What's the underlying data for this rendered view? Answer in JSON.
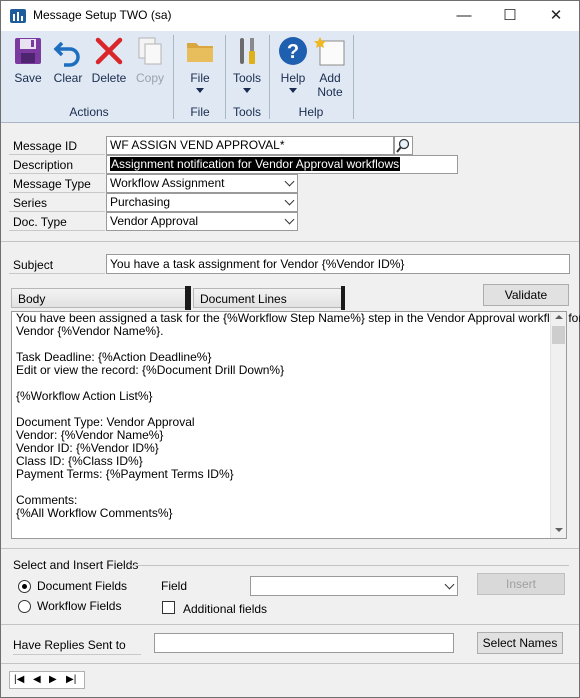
{
  "window": {
    "title": "Message Setup   TWO (sa)",
    "minimize_glyph": "—",
    "maximize_glyph": "☐",
    "close_glyph": "✕"
  },
  "ribbon": {
    "groups": [
      {
        "label": "Actions",
        "buttons": [
          {
            "label": "Save",
            "icon": "save-icon"
          },
          {
            "label": "Clear",
            "icon": "undo-icon"
          },
          {
            "label": "Delete",
            "icon": "delete-icon"
          },
          {
            "label": "Copy",
            "icon": "copy-icon",
            "disabled": true
          }
        ]
      },
      {
        "label": "File",
        "buttons": [
          {
            "label": "File",
            "icon": "folder-icon"
          }
        ]
      },
      {
        "label": "Tools",
        "buttons": [
          {
            "label": "Tools",
            "icon": "tools-icon"
          }
        ]
      },
      {
        "label": "Help",
        "buttons": [
          {
            "label": "Help",
            "icon": "help-icon"
          },
          {
            "label_line1": "Add",
            "label_line2": "Note",
            "icon": "add-note-icon"
          }
        ]
      }
    ]
  },
  "form": {
    "message_id": {
      "label": "Message ID",
      "value": "WF ASSIGN VEND APPROVAL*"
    },
    "description": {
      "label": "Description",
      "value": "Assignment notification for Vendor Approval workflows"
    },
    "message_type": {
      "label": "Message Type",
      "value": "Workflow Assignment"
    },
    "series": {
      "label": "Series",
      "value": "Purchasing"
    },
    "doc_type": {
      "label": "Doc. Type",
      "value": "Vendor Approval"
    },
    "subject": {
      "label": "Subject",
      "value": "You have a task assignment for Vendor  {%Vendor ID%}"
    }
  },
  "tabs": {
    "body": "Body",
    "document_lines": "Document Lines"
  },
  "validate_label": "Validate",
  "body_lines": [
    "You have been assigned a task for the {%Workflow Step Name%} step in the Vendor Approval workflow for",
    "Vendor {%Vendor Name%}.",
    "",
    "Task Deadline: {%Action Deadline%}",
    "Edit or view the record: {%Document Drill Down%}",
    "",
    "{%Workflow Action List%}",
    "",
    "Document Type: Vendor Approval",
    "Vendor: {%Vendor Name%}",
    "Vendor ID: {%Vendor ID%}",
    "Class ID: {%Class ID%}",
    "Payment Terms: {%Payment Terms ID%}",
    "",
    "Comments:",
    "{%All Workflow Comments%}"
  ],
  "insert": {
    "title": "Select and Insert Fields",
    "doc_fields": "Document Fields",
    "workflow_fields": "Workflow Fields",
    "field_label": "Field",
    "field_value": "",
    "additional_fields": "Additional fields",
    "insert_label": "Insert"
  },
  "replies": {
    "label": "Have Replies Sent to",
    "value": "",
    "select_names": "Select Names"
  }
}
